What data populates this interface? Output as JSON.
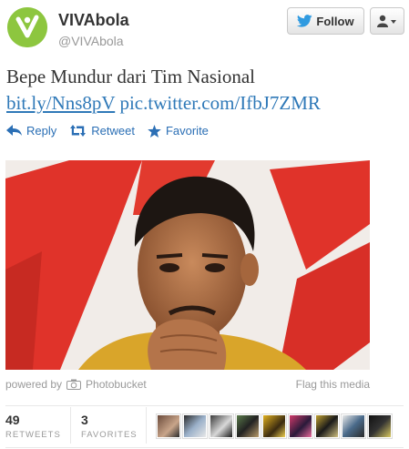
{
  "account": {
    "name": "VIVAbola",
    "handle": "@VIVAbola",
    "brand_color": "#8dc63f"
  },
  "header": {
    "follow_label": "Follow",
    "follow_icon": "twitter-bird-icon",
    "user_menu_icon": "user-dropdown-icon"
  },
  "tweet": {
    "text": "Bepe Mundur dari Tim Nasional",
    "link_1": "bit.ly/Nns8pV",
    "link_2": "pic.twitter.com/IfbJ7ZMR",
    "link_color": "#2f79b8"
  },
  "actions": {
    "reply_label": "Reply",
    "retweet_label": "Retweet",
    "favorite_label": "Favorite"
  },
  "media": {
    "powered_by_label": "powered by",
    "provider_label": "Photobucket",
    "flag_label": "Flag this media"
  },
  "stats": {
    "retweets_count": "49",
    "retweets_label": "RETWEETS",
    "favorites_count": "3",
    "favorites_label": "FAVORITES",
    "avatar_count": 9
  }
}
